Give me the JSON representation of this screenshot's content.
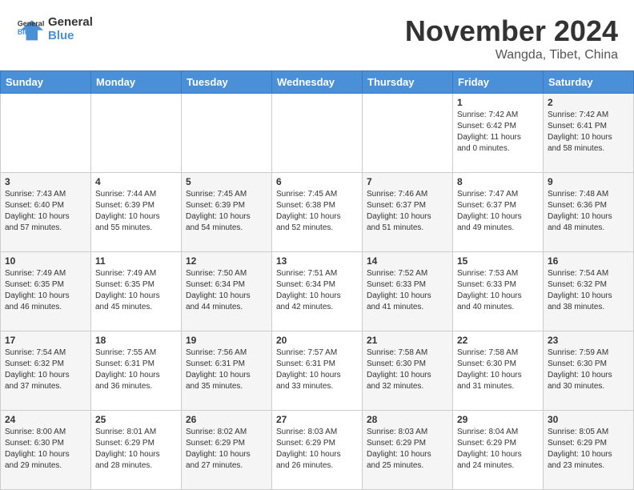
{
  "header": {
    "logo_line1": "General",
    "logo_line2": "Blue",
    "month": "November 2024",
    "location": "Wangda, Tibet, China"
  },
  "weekdays": [
    "Sunday",
    "Monday",
    "Tuesday",
    "Wednesday",
    "Thursday",
    "Friday",
    "Saturday"
  ],
  "weeks": [
    [
      {
        "day": "",
        "info": ""
      },
      {
        "day": "",
        "info": ""
      },
      {
        "day": "",
        "info": ""
      },
      {
        "day": "",
        "info": ""
      },
      {
        "day": "",
        "info": ""
      },
      {
        "day": "1",
        "info": "Sunrise: 7:42 AM\nSunset: 6:42 PM\nDaylight: 11 hours\nand 0 minutes."
      },
      {
        "day": "2",
        "info": "Sunrise: 7:42 AM\nSunset: 6:41 PM\nDaylight: 10 hours\nand 58 minutes."
      }
    ],
    [
      {
        "day": "3",
        "info": "Sunrise: 7:43 AM\nSunset: 6:40 PM\nDaylight: 10 hours\nand 57 minutes."
      },
      {
        "day": "4",
        "info": "Sunrise: 7:44 AM\nSunset: 6:39 PM\nDaylight: 10 hours\nand 55 minutes."
      },
      {
        "day": "5",
        "info": "Sunrise: 7:45 AM\nSunset: 6:39 PM\nDaylight: 10 hours\nand 54 minutes."
      },
      {
        "day": "6",
        "info": "Sunrise: 7:45 AM\nSunset: 6:38 PM\nDaylight: 10 hours\nand 52 minutes."
      },
      {
        "day": "7",
        "info": "Sunrise: 7:46 AM\nSunset: 6:37 PM\nDaylight: 10 hours\nand 51 minutes."
      },
      {
        "day": "8",
        "info": "Sunrise: 7:47 AM\nSunset: 6:37 PM\nDaylight: 10 hours\nand 49 minutes."
      },
      {
        "day": "9",
        "info": "Sunrise: 7:48 AM\nSunset: 6:36 PM\nDaylight: 10 hours\nand 48 minutes."
      }
    ],
    [
      {
        "day": "10",
        "info": "Sunrise: 7:49 AM\nSunset: 6:35 PM\nDaylight: 10 hours\nand 46 minutes."
      },
      {
        "day": "11",
        "info": "Sunrise: 7:49 AM\nSunset: 6:35 PM\nDaylight: 10 hours\nand 45 minutes."
      },
      {
        "day": "12",
        "info": "Sunrise: 7:50 AM\nSunset: 6:34 PM\nDaylight: 10 hours\nand 44 minutes."
      },
      {
        "day": "13",
        "info": "Sunrise: 7:51 AM\nSunset: 6:34 PM\nDaylight: 10 hours\nand 42 minutes."
      },
      {
        "day": "14",
        "info": "Sunrise: 7:52 AM\nSunset: 6:33 PM\nDaylight: 10 hours\nand 41 minutes."
      },
      {
        "day": "15",
        "info": "Sunrise: 7:53 AM\nSunset: 6:33 PM\nDaylight: 10 hours\nand 40 minutes."
      },
      {
        "day": "16",
        "info": "Sunrise: 7:54 AM\nSunset: 6:32 PM\nDaylight: 10 hours\nand 38 minutes."
      }
    ],
    [
      {
        "day": "17",
        "info": "Sunrise: 7:54 AM\nSunset: 6:32 PM\nDaylight: 10 hours\nand 37 minutes."
      },
      {
        "day": "18",
        "info": "Sunrise: 7:55 AM\nSunset: 6:31 PM\nDaylight: 10 hours\nand 36 minutes."
      },
      {
        "day": "19",
        "info": "Sunrise: 7:56 AM\nSunset: 6:31 PM\nDaylight: 10 hours\nand 35 minutes."
      },
      {
        "day": "20",
        "info": "Sunrise: 7:57 AM\nSunset: 6:31 PM\nDaylight: 10 hours\nand 33 minutes."
      },
      {
        "day": "21",
        "info": "Sunrise: 7:58 AM\nSunset: 6:30 PM\nDaylight: 10 hours\nand 32 minutes."
      },
      {
        "day": "22",
        "info": "Sunrise: 7:58 AM\nSunset: 6:30 PM\nDaylight: 10 hours\nand 31 minutes."
      },
      {
        "day": "23",
        "info": "Sunrise: 7:59 AM\nSunset: 6:30 PM\nDaylight: 10 hours\nand 30 minutes."
      }
    ],
    [
      {
        "day": "24",
        "info": "Sunrise: 8:00 AM\nSunset: 6:30 PM\nDaylight: 10 hours\nand 29 minutes."
      },
      {
        "day": "25",
        "info": "Sunrise: 8:01 AM\nSunset: 6:29 PM\nDaylight: 10 hours\nand 28 minutes."
      },
      {
        "day": "26",
        "info": "Sunrise: 8:02 AM\nSunset: 6:29 PM\nDaylight: 10 hours\nand 27 minutes."
      },
      {
        "day": "27",
        "info": "Sunrise: 8:03 AM\nSunset: 6:29 PM\nDaylight: 10 hours\nand 26 minutes."
      },
      {
        "day": "28",
        "info": "Sunrise: 8:03 AM\nSunset: 6:29 PM\nDaylight: 10 hours\nand 25 minutes."
      },
      {
        "day": "29",
        "info": "Sunrise: 8:04 AM\nSunset: 6:29 PM\nDaylight: 10 hours\nand 24 minutes."
      },
      {
        "day": "30",
        "info": "Sunrise: 8:05 AM\nSunset: 6:29 PM\nDaylight: 10 hours\nand 23 minutes."
      }
    ]
  ]
}
